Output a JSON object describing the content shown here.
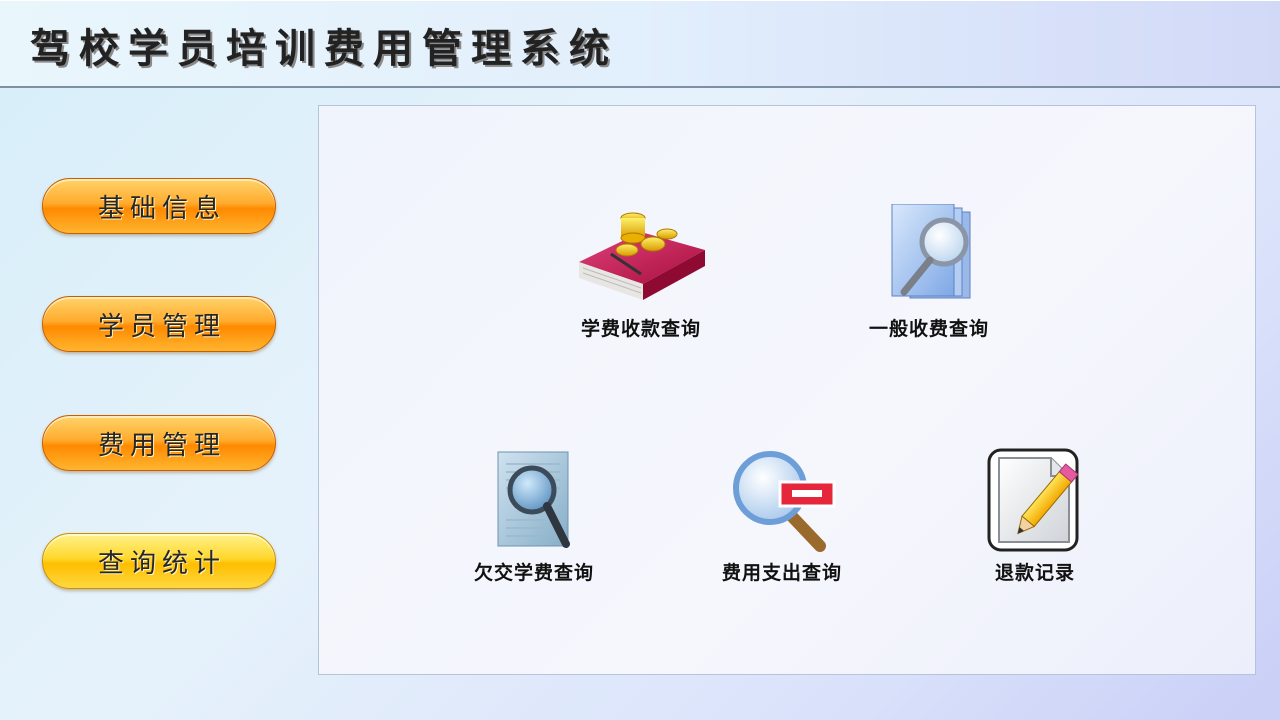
{
  "app": {
    "title": "驾校学员培训费用管理系统"
  },
  "sidebar": {
    "items": [
      {
        "label": "基础信息"
      },
      {
        "label": "学员管理"
      },
      {
        "label": "费用管理"
      },
      {
        "label": "查询统计"
      }
    ]
  },
  "main": {
    "tiles": [
      {
        "label": "学费收款查询",
        "icon": "money-book-icon"
      },
      {
        "label": "一般收费查询",
        "icon": "document-search-icon"
      },
      {
        "label": "欠交学费查询",
        "icon": "paper-magnifier-icon"
      },
      {
        "label": "费用支出查询",
        "icon": "magnifier-minus-icon"
      },
      {
        "label": "退款记录",
        "icon": "edit-document-icon"
      }
    ]
  },
  "colors": {
    "button_orange": "#ff9a10",
    "button_yellow": "#ffd21e",
    "panel_bg": "#f3f6fc"
  }
}
